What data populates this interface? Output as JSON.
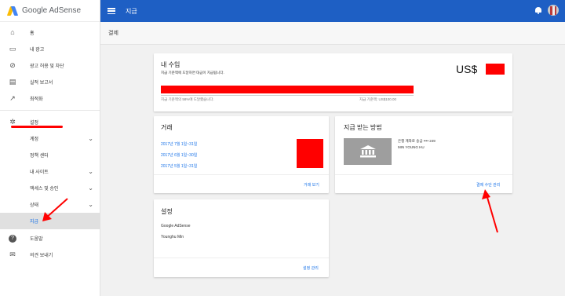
{
  "app": {
    "logo_text": "Google AdSense"
  },
  "topbar": {
    "title": "지급"
  },
  "page": {
    "header": "결제"
  },
  "sidebar": {
    "items": [
      {
        "label": "홈",
        "icon": "home-icon",
        "glyph": "⌂"
      },
      {
        "label": "내 광고",
        "icon": "ad-units-icon",
        "glyph": "▭"
      },
      {
        "label": "광고 허용 및 차단",
        "icon": "block-icon",
        "glyph": "⊘"
      },
      {
        "label": "실적 보고서",
        "icon": "reports-icon",
        "glyph": "▤"
      },
      {
        "label": "최적화",
        "icon": "optimization-icon",
        "glyph": "↗"
      },
      {
        "label": "설정",
        "icon": "gear-icon",
        "glyph": "✲"
      },
      {
        "label": "계정"
      },
      {
        "label": "정책 센터"
      },
      {
        "label": "내 사이트"
      },
      {
        "label": "액세스 및 승인"
      },
      {
        "label": "상태"
      },
      {
        "label": "지급"
      },
      {
        "label": "도움말",
        "icon": "help-icon",
        "glyph": "?"
      },
      {
        "label": "의견 보내기",
        "icon": "feedback-icon",
        "glyph": "✉"
      }
    ]
  },
  "earnings": {
    "title": "내 수입",
    "subtitle": "지급 기준액에 도달하면 대금이 지급됩니다.",
    "amount_prefix": "US$",
    "progress_label": "지급 기준액의 58%에 도달했습니다.",
    "threshold_label": "지급 기준액: US$100.00"
  },
  "transactions": {
    "title": "거래",
    "rows": [
      "2017년 7월 1일~31일",
      "2017년 6월 1일~30일",
      "2017년 5월 1일~31일"
    ],
    "view_link": "거래 보기"
  },
  "payment": {
    "title": "지급 받는 방법",
    "method": "은행 계좌로 송금 •••• 249",
    "holder": "MIN YOUNG HU",
    "manage_link": "결제 수단 관리"
  },
  "settings": {
    "title": "설정",
    "line1": "Google AdSense",
    "line2": "Younghu Min",
    "manage_link": "설정 관리"
  },
  "colors": {
    "brand_blue": "#1e5fc4",
    "link_blue": "#1a73e8",
    "redaction": "#ff0000"
  }
}
